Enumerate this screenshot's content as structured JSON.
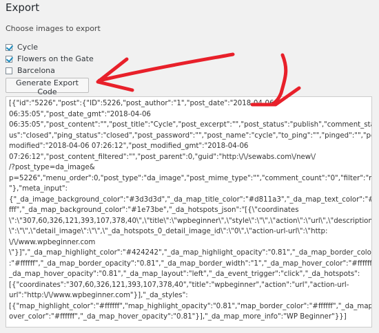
{
  "section": {
    "title": "Export",
    "subtitle": "Choose images to export"
  },
  "images": [
    {
      "label": "Cycle",
      "checked": true
    },
    {
      "label": "Flowers on the Gate",
      "checked": true
    },
    {
      "label": "Barcelona",
      "checked": false
    }
  ],
  "generate_button_label": "Generate Export Code",
  "export_code": "[{\"id\":\"5226\",\"post\":{\"ID\":5226,\"post_author\":\"1\",\"post_date\":\"2018-04-06\n06:35:05\",\"post_date_gmt\":\"2018-04-06\n06:35:05\",\"post_content\":\"\",\"post_title\":\"Cycle\",\"post_excerpt\":\"\",\"post_status\":\"publish\",\"comment_stat\nus\":\"closed\",\"ping_status\":\"closed\",\"post_password\":\"\",\"post_name\":\"cycle\",\"to_ping\":\"\",\"pinged\":\"\",\"post_\nmodified\":\"2018-04-06 07:26:12\",\"post_modified_gmt\":\"2018-04-06\n07:26:12\",\"post_content_filtered\":\"\",\"post_parent\":0,\"guid\":\"http:\\/\\/sewabs.com\\/new\\/\n/?post_type=da_image&\np=5226\",\"menu_order\":0,\"post_type\":\"da_image\",\"post_mime_type\":\"\",\"comment_count\":\"0\",\"filter\":\"raw\n\"},\"meta_input\":\n{\"_da_image_background_color\":\"#3d3d3d\",\"_da_map_title_color\":\"#d811a3\",\"_da_map_text_color\":\"#fff\nfff\",\"_da_map_background_color\":\"#1e73be\",\"_da_hotspots_json\":\"[{\\\"coordinates\n\\\":\\\"307,60,326,121,393,107,378,40\\\",\\\"title\\\":\\\"wpbeginner\\\",\\\"style\\\":\\\"\\\",\\\"action\\\":\\\"url\\\",\\\"description\n\\\":\\\"\\\",\\\"detail_image\\\":\\\"\\\",\\\"_da_hotspots_0_detail_image_id\\\":\\\"0\\\",\\\"action-url-url\\\":\\\"http:\n\\/\\/www.wpbeginner.com\n\\\"}]\",\"_da_map_highlight_color\":\"#424242\",\"_da_map_highlight_opacity\":\"0.81\",\"_da_map_border_color\"\n:\"#ffffff\",\"_da_map_border_opacity\":\"0.81\",\"_da_map_border_width\":\"1\",\"_da_map_hover_color\":\"#ffffff\",\"\n_da_map_hover_opacity\":\"0.81\",\"_da_map_layout\":\"left\",\"_da_event_trigger\":\"click\",\"_da_hotspots\":\n[{\"coordinates\":\"307,60,326,121,393,107,378,40\",\"title\":\"wpbeginner\",\"action\":\"url\",\"action-url-\nurl\":\"http:\\/\\/www.wpbeginner.com\"}],\"_da_styles\":\n[{\"map_highlight_color\":\"#ffffff\",\"map_highlight_opacity\":\"0.81\",\"map_border_color\":\"#ffffff\",\"_da_map_h\nover_color\":\"#ffffff\",\"_da_map_hover_opacity\":\"0.81\"}],\"_da_map_more_info\":\"WP Beginner\"}}]",
  "colors": {
    "annotation_arrow": "#e8202a"
  }
}
